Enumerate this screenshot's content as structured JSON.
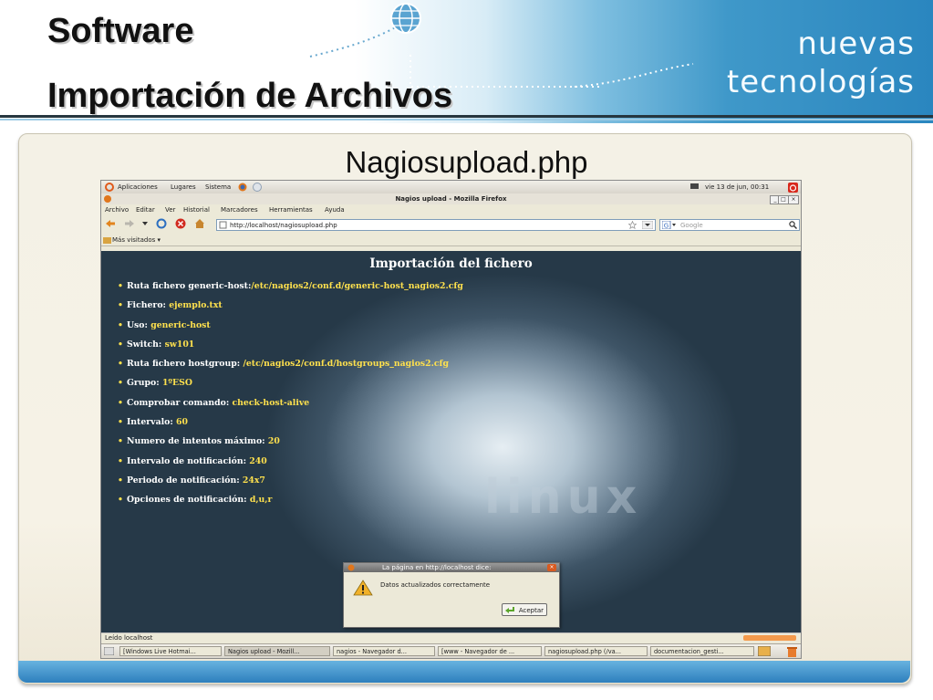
{
  "slide": {
    "title_line1": "Software",
    "title_line2": "Importación de Archivos",
    "brand_line1": "nuevas",
    "brand_line2": "tecnologías",
    "subtitle": "Nagiosupload.php"
  },
  "gnome_panel": {
    "menus": [
      "Aplicaciones",
      "Lugares",
      "Sistema"
    ],
    "clock": "vie 13 de jun, 00:31"
  },
  "window": {
    "title": "Nagios upload - Mozilla Firefox",
    "menu": [
      "Archivo",
      "Editar",
      "Ver",
      "Historial",
      "Marcadores",
      "Herramientas",
      "Ayuda"
    ],
    "url": "http://localhost/nagiosupload.php",
    "search_placeholder": "Google",
    "bookmarks_label": "Más visitados ▾",
    "status_text": "Leído localhost"
  },
  "page": {
    "heading": "Importación del fichero",
    "items": [
      {
        "label": "Ruta fichero generic-host:",
        "value": "/etc/nagios2/conf.d/generic-host_nagios2.cfg"
      },
      {
        "label": "Fichero:",
        "value": "ejemplo.txt"
      },
      {
        "label": "Uso:",
        "value": "generic-host"
      },
      {
        "label": "Switch:",
        "value": "sw101"
      },
      {
        "label": "Ruta fichero hostgroup:",
        "value": "/etc/nagios2/conf.d/hostgroups_nagios2.cfg"
      },
      {
        "label": "Grupo:",
        "value": "1ºESO"
      },
      {
        "label": "Comprobar comando:",
        "value": "check-host-alive"
      },
      {
        "label": "Intervalo:",
        "value": "60"
      },
      {
        "label": "Numero de intentos máximo:",
        "value": "20"
      },
      {
        "label": "Intervalo de notificación:",
        "value": "240"
      },
      {
        "label": "Periodo de notificación:",
        "value": "24x7"
      },
      {
        "label": "Opciones de notificación:",
        "value": "d,u,r"
      }
    ],
    "background_word": "linux"
  },
  "dialog": {
    "title": "La página en http://localhost dice:",
    "message": "Datos actualizados correctamente",
    "ok_label": "Aceptar"
  },
  "taskbar": [
    "[Windows Live Hotmai...",
    "Nagios upload - Mozill...",
    "nagios - Navegador d...",
    "[www - Navegador de ...",
    "nagiosupload.php (/va...",
    "documentacion_gesti..."
  ],
  "colors": {
    "value_yellow": "#ffe14d",
    "header_blue": "#2a86bf"
  }
}
